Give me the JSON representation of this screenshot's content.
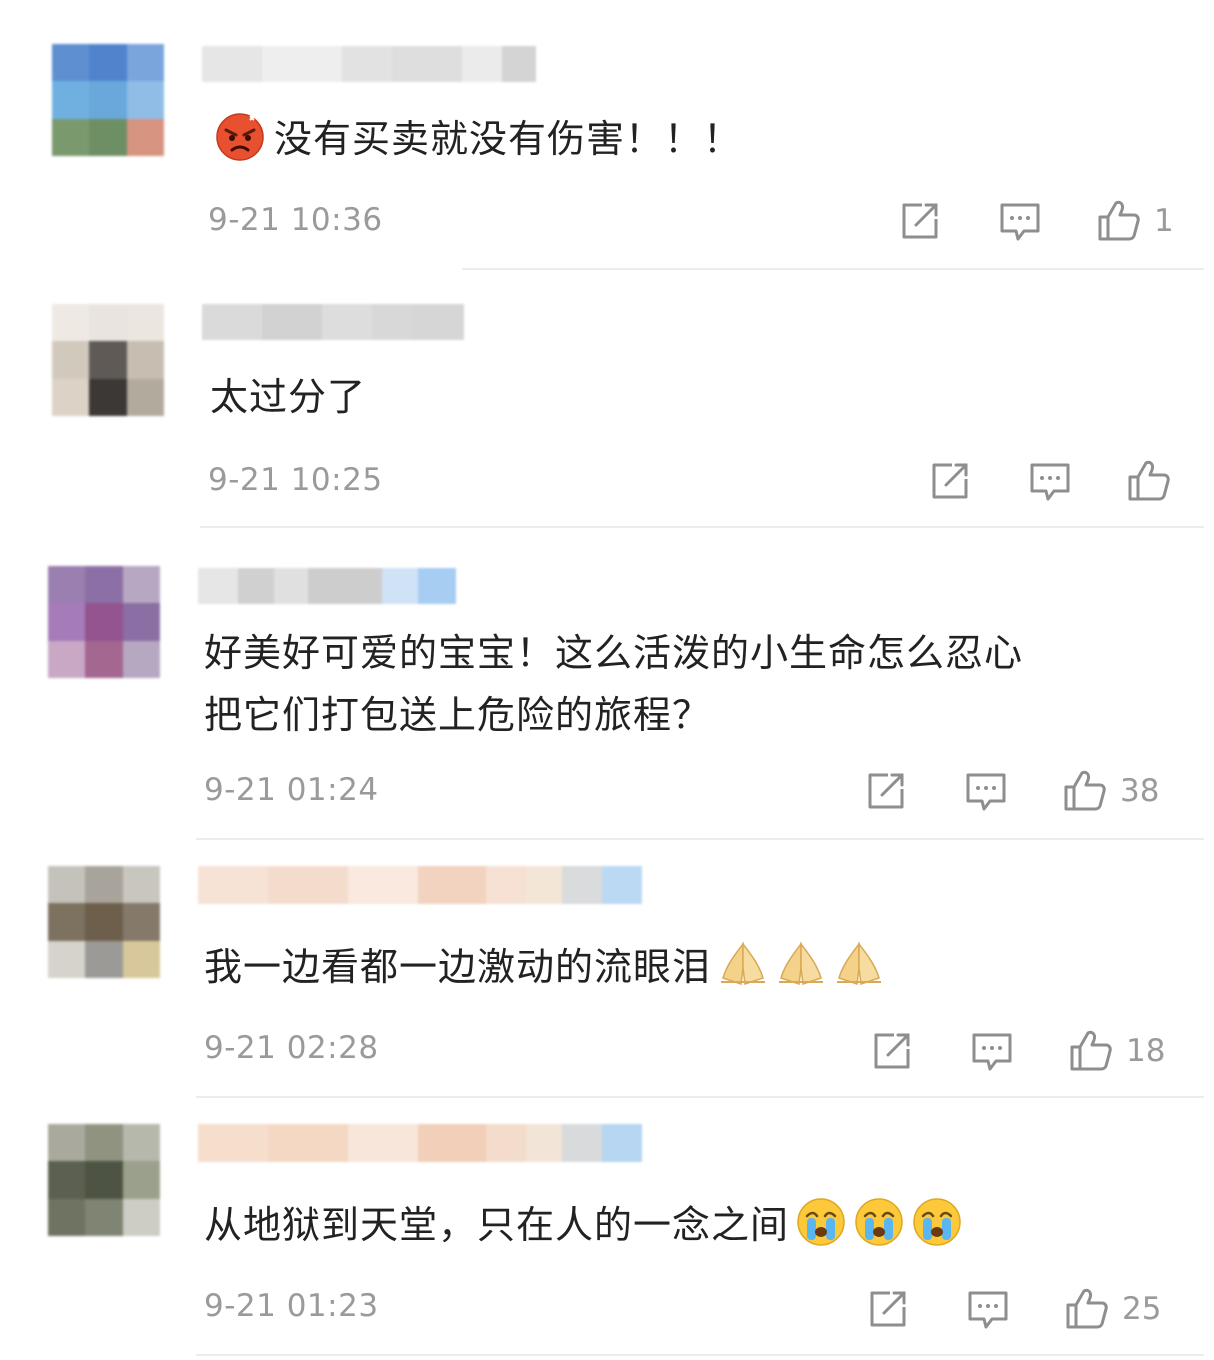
{
  "colors": {
    "text": "#222222",
    "meta": "#9a9a9a",
    "divider": "#ececec",
    "icon": "#8e8e8e"
  },
  "comments": [
    {
      "text": "没有买卖就没有伤害！！！",
      "leading_emoji": "angry-face-emoji",
      "time": "9-21 10:36",
      "likes": "1"
    },
    {
      "text": "太过分了",
      "time": "9-21 10:25",
      "likes": ""
    },
    {
      "text_line1": "好美好可爱的宝宝！这么活泼的小生命怎么忍心",
      "text_line2": "把它们打包送上危险的旅程？",
      "time": "9-21 01:24",
      "likes": "38"
    },
    {
      "text": "我一边看都一边激动的流眼泪",
      "trailing_emoji": "praying-hands-emoji",
      "time": "9-21 02:28",
      "likes": "18"
    },
    {
      "text": "从地狱到天堂，只在人的一念之间",
      "trailing_emoji": "crying-face-emoji",
      "time": "9-21 01:23",
      "likes": "25"
    }
  ]
}
